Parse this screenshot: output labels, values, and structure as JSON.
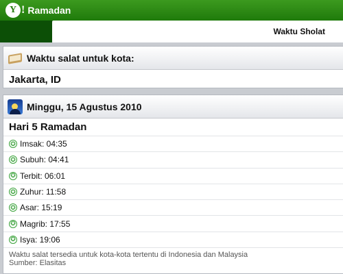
{
  "app": {
    "logo_text": "Y",
    "logo_bang": "!",
    "title": "Ramadan"
  },
  "tabs": {
    "active_label": "Waktu Sholat"
  },
  "city_panel": {
    "heading": "Waktu salat untuk kota:",
    "city": "Jakarta, ID"
  },
  "schedule_panel": {
    "date": "Minggu, 15 Agustus 2010",
    "day_label": "Hari 5 Ramadan",
    "prayers": [
      {
        "label": "Imsak: 04:35"
      },
      {
        "label": "Subuh: 04:41"
      },
      {
        "label": "Terbit: 06:01"
      },
      {
        "label": "Zuhur: 11:58"
      },
      {
        "label": "Asar: 15:19"
      },
      {
        "label": "Magrib: 17:55"
      },
      {
        "label": "Isya: 19:06"
      }
    ],
    "note": "Waktu salat tersedia untuk kota-kota tertentu di Indonesia dan Malaysia",
    "source": "Sumber: Elasitas"
  },
  "colors": {
    "header_green": "#2a8a14",
    "tab_dark": "#0c4f06",
    "star_green": "#3aa23a"
  },
  "icons": {
    "city_icon": "book-icon",
    "date_icon": "mosque-night-icon",
    "prayer_icon": "star-circle-icon"
  }
}
